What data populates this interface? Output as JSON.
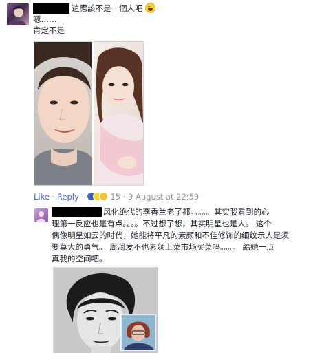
{
  "comment1": {
    "text_line1": "這應該不是一個人吧",
    "text_line2": "嗯……",
    "text_line3": "肯定不是",
    "emoji_icon": "laughing-emoji",
    "actions": {
      "like": "Like",
      "sep1": "·",
      "reply": "Reply",
      "sep2": "·",
      "reaction_count": "15",
      "sep3": "·",
      "timestamp": "9 August at 22:59"
    },
    "reaction_icons": [
      "like-icon",
      "laugh-icon",
      "wow-icon"
    ]
  },
  "reply": {
    "line1": "风化绝代的李香兰老了都。。。。。其实我看到的心",
    "line2": "理第一反应也是有点。。。。不过想了想，其实明星也是人。 这个",
    "line3": "偶像明星如云的时代，她能将平凡的素颜和不佳修饰的细纹示人是须",
    "line4": "要莫大的勇气。 周润发不也素颜上菜市场买菜吗。。。。 給她一点",
    "line5": "真我的空间吧。"
  },
  "colors": {
    "link": "#4267b2",
    "meta": "#90949c",
    "text": "#1d2129",
    "reaction_like": "#4267b2",
    "reaction_emoji": "#f7d23f"
  }
}
